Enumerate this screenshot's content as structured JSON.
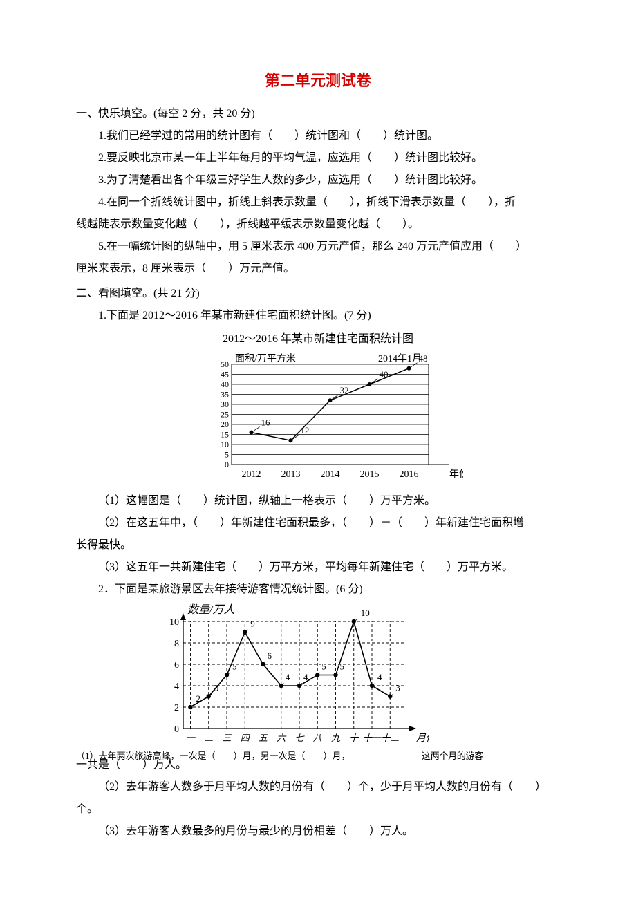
{
  "title": "第二单元测试卷",
  "sec1": {
    "head": "一、快乐填空。(每空 2 分，共 20 分)",
    "q1": "1.我们已经学过的常用的统计图有（　　）统计图和（　　）统计图。",
    "q2": "2.要反映北京市某一年上半年每月的平均气温，应选用（　　）统计图比较好。",
    "q3": "3.为了清楚看出各个年级三好学生人数的多少，应选用（　　）统计图比较好。",
    "q4a": "4.在同一个折线统计图中，折线上斜表示数量（　　），折线下滑表示数量（　　），折",
    "q4b": "线越陡表示数量变化越（　　），折线越平缓表示数量变化越（　　）。",
    "q5a": "5.在一幅统计图的纵轴中，用 5 厘米表示 400 万元产值，那么 240 万元产值应用（　　）",
    "q5b": "厘米来表示，8 厘米表示（　　）万元产值。"
  },
  "sec2": {
    "head": "二、看图填空。(共 21 分)",
    "q1": "1.下面是 2012～2016 年某市新建住宅面积统计图。(7 分)",
    "chart1_title": "2012～2016 年某市新建住宅面积统计图",
    "q1_1": "（1）这幅图是（　　）统计图，纵轴上一格表示（　　）万平方米。",
    "q1_2a": "（2）在这五年中，（　　）年新建住宅面积最多，（　　）－（　　）年新建住宅面积增",
    "q1_2b": "长得最快。",
    "q1_3": "（3）这五年一共新建住宅（　　）万平方米，平均每年新建住宅（　　）万平方米。",
    "q2": "2．下面是某旅游景区去年接待游客情况统计图。(6 分)",
    "q2_1a": "（1）去年两次旅游高峰，一次是（　　）月，另一次是（　　）月，",
    "q2_1b": "这两个月的游客",
    "q2_1c": "一共是（　　）万人。",
    "q2_2a": "（2）去年游客人数多于月平均人数的月份有（　　）个，少于月平均人数的月份有（　　）",
    "q2_2b": "个。",
    "q2_3": "（3）去年游客人数最多的月份与最少的月份相差（　　）万人。"
  },
  "chart_data": [
    {
      "type": "line",
      "title": "2012～2016 年某市新建住宅面积统计图",
      "ylabel": "面积/万平方米",
      "xlabel": "年份",
      "annotation": "2014年1月",
      "categories": [
        "2012",
        "2013",
        "2014",
        "2015",
        "2016"
      ],
      "values": [
        16,
        12,
        32,
        40,
        48
      ],
      "ylim": [
        0,
        50
      ],
      "yticks": [
        0,
        5,
        10,
        15,
        20,
        25,
        30,
        35,
        40,
        45,
        50
      ]
    },
    {
      "type": "line",
      "title": "",
      "ylabel": "数量/万人",
      "xlabel": "月份",
      "categories": [
        "一",
        "二",
        "三",
        "四",
        "五",
        "六",
        "七",
        "八",
        "九",
        "十",
        "十一",
        "十二"
      ],
      "values": [
        2,
        3,
        5,
        9,
        6,
        4,
        4,
        5,
        5,
        10,
        4,
        3
      ],
      "ylim": [
        0,
        10
      ],
      "yticks": [
        0,
        2,
        4,
        6,
        8,
        10
      ]
    }
  ]
}
